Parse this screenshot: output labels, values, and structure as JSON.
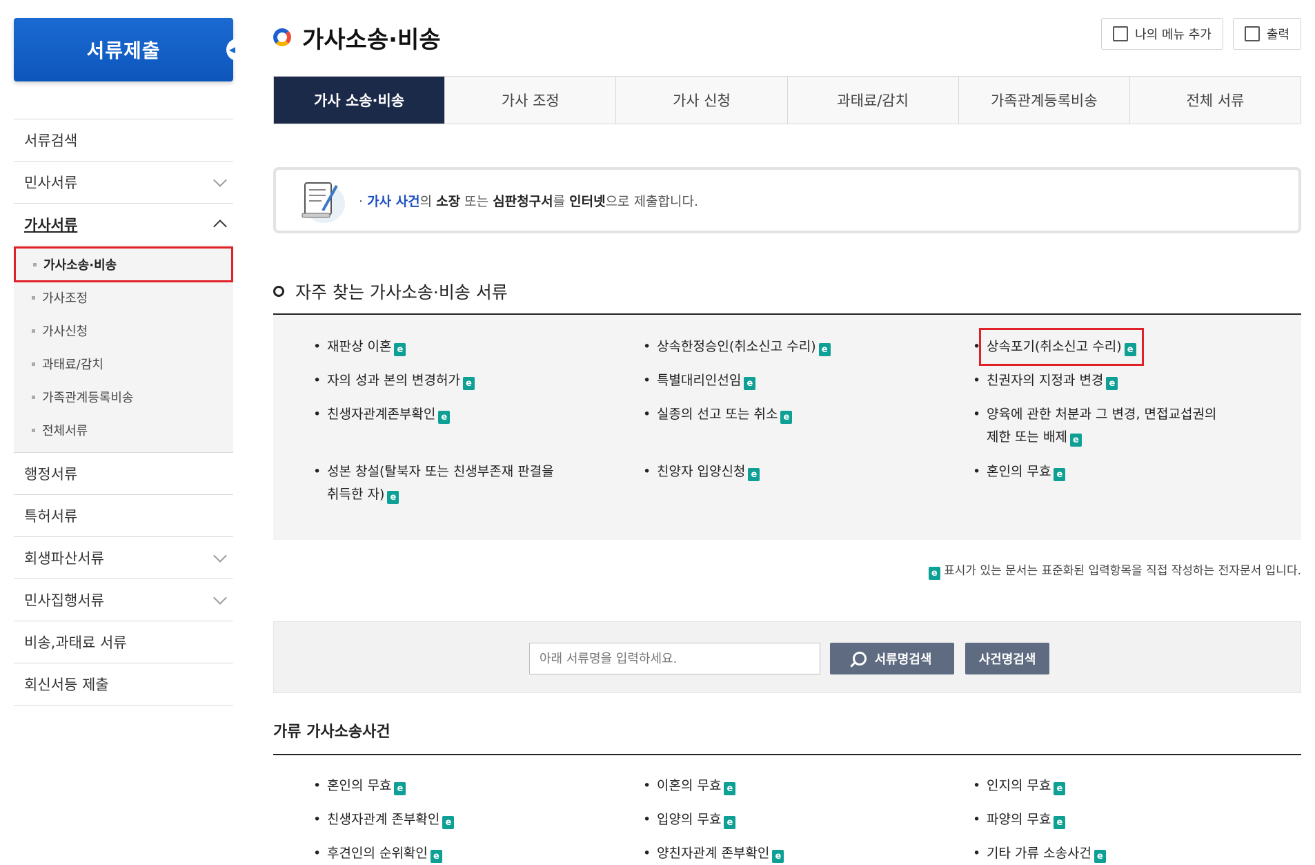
{
  "sidebar": {
    "header": "서류제출",
    "items": [
      {
        "label": "서류검색"
      },
      {
        "label": "민사서류"
      },
      {
        "label": "가사서류"
      },
      {
        "label": "행정서류"
      },
      {
        "label": "특허서류"
      },
      {
        "label": "회생파산서류"
      },
      {
        "label": "민사집행서류"
      },
      {
        "label": "비송,과태료 서류"
      },
      {
        "label": "회신서등 제출"
      }
    ],
    "sub_items": [
      {
        "label": "가사소송·비송"
      },
      {
        "label": "가사조정"
      },
      {
        "label": "가사신청"
      },
      {
        "label": "과태료/감치"
      },
      {
        "label": "가족관계등록비송"
      },
      {
        "label": "전체서류"
      }
    ]
  },
  "main": {
    "title": "가사소송·비송",
    "buttons": {
      "add_menu": "나의 메뉴 추가",
      "print": "출력"
    },
    "tabs": [
      {
        "label": "가사 소송·비송"
      },
      {
        "label": "가사 조정"
      },
      {
        "label": "가사 신청"
      },
      {
        "label": "과태료/감치"
      },
      {
        "label": "가족관계등록비송"
      },
      {
        "label": "전체 서류"
      }
    ],
    "notice": {
      "p1": "가사 사건",
      "p2": "의 ",
      "p3": "소장",
      "p4": " 또는 ",
      "p5": "심판청구서",
      "p6": "를 ",
      "p7": "인터넷",
      "p8": "으로 제출합니다."
    },
    "frequent_title": "자주 찾는 가사소송·비송 서류",
    "frequent_docs": [
      {
        "line1": "재판상 이혼"
      },
      {
        "line1": "상속한정승인(취소신고 수리)"
      },
      {
        "line1": "상속포기(취소신고 수리)"
      },
      {
        "line1": "자의 성과 본의 변경허가"
      },
      {
        "line1": "특별대리인선임"
      },
      {
        "line1": "친권자의 지정과 변경"
      },
      {
        "line1": "친생자관계존부확인"
      },
      {
        "line1": "실종의 선고 또는 취소"
      },
      {
        "line1": "양육에 관한 처분과 그 변경, 면접교섭권의",
        "line2": "제한 또는 배제"
      },
      {
        "line1": "성본 창설(탈북자 또는 친생부존재 판결을",
        "line2": "취득한 자)"
      },
      {
        "line1": "친양자 입양신청"
      },
      {
        "line1": "혼인의 무효"
      }
    ],
    "e_badge": "e",
    "legend_text": "표시가 있는 문서는 표준화된 입력항목을 직접 작성하는 전자문서 입니다.",
    "search": {
      "placeholder": "아래 서류명을 입력하세요.",
      "doc_search_btn": "서류명검색",
      "case_search_btn": "사건명검색"
    },
    "category_title": "가류 가사소송사건",
    "category_docs": [
      {
        "label": "혼인의 무효"
      },
      {
        "label": "이혼의 무효"
      },
      {
        "label": "인지의 무효"
      },
      {
        "label": "친생자관계 존부확인"
      },
      {
        "label": "입양의 무효"
      },
      {
        "label": "파양의 무효"
      },
      {
        "label": "후견인의 순위확인"
      },
      {
        "label": "양친자관계 존부확인"
      },
      {
        "label": "기타 가류 소송사건"
      }
    ]
  }
}
